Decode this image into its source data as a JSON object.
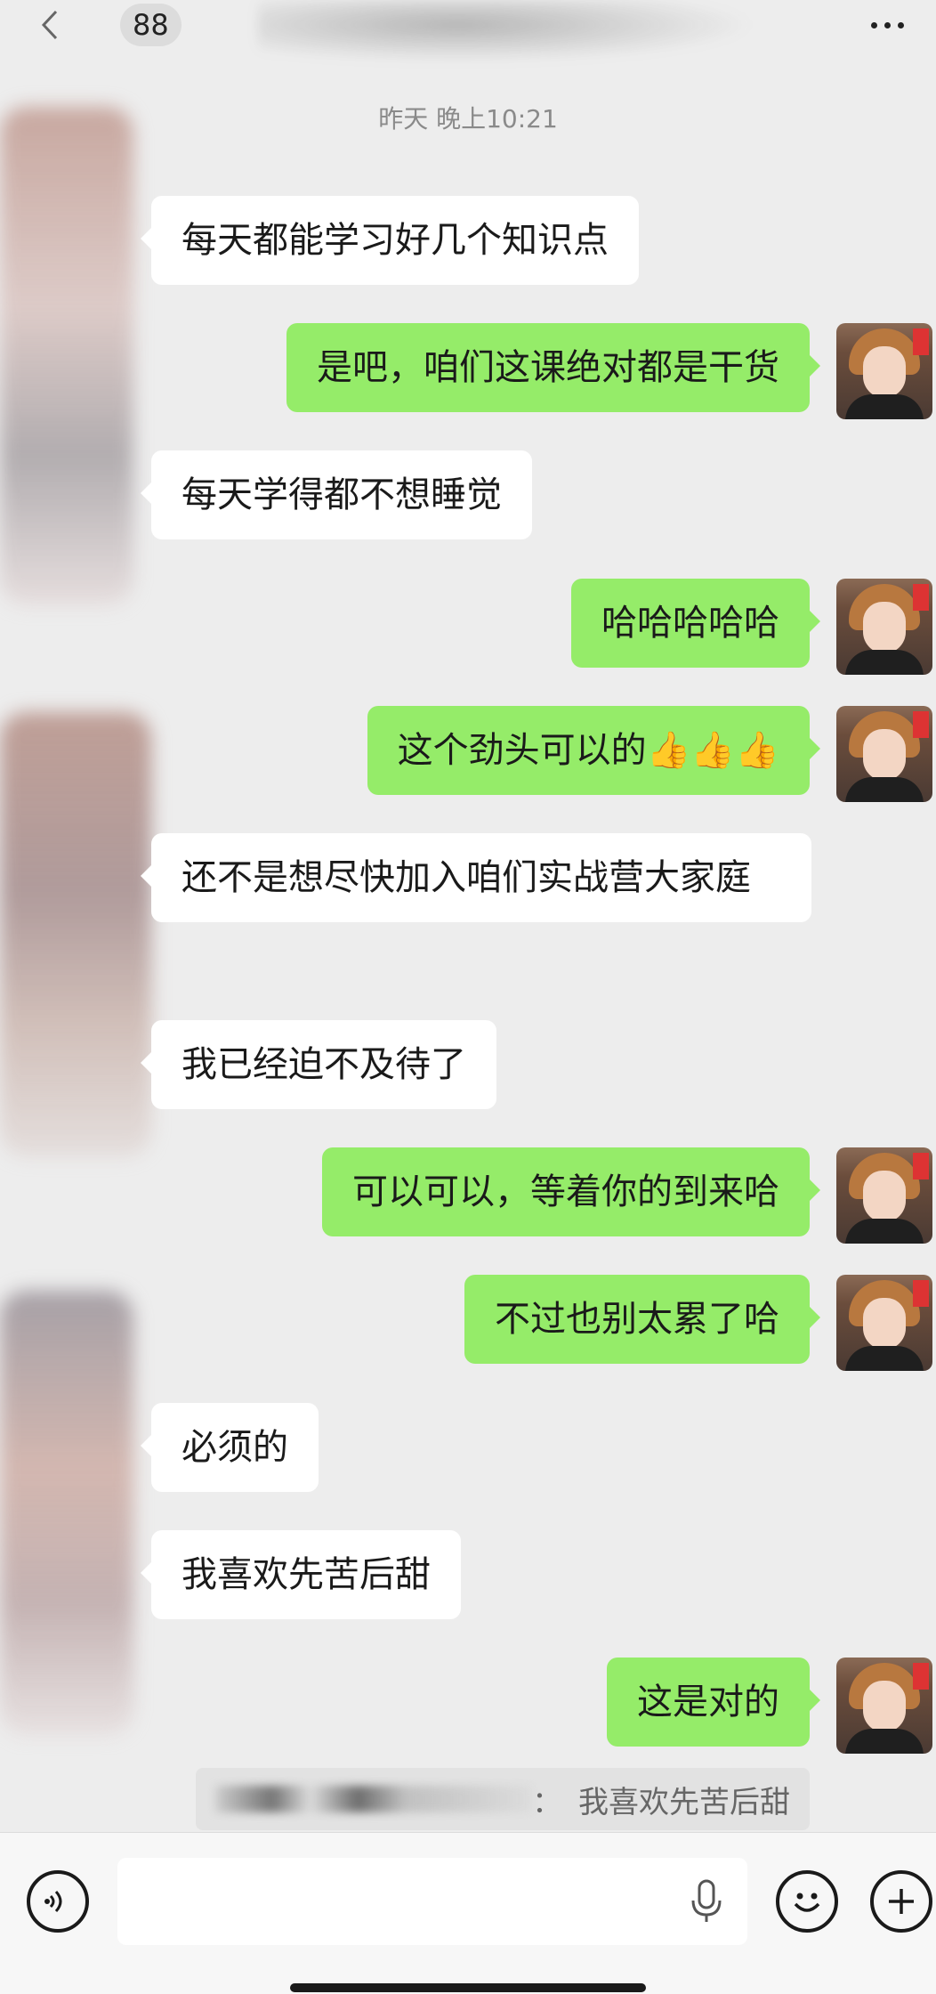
{
  "header": {
    "unread_count": "88",
    "back_icon": "chevron-left-icon",
    "more_icon": "more-dots-icon"
  },
  "timestamp": "昨天 晚上10:21",
  "messages": [
    {
      "side": "recv",
      "text": "每天都能学习好几个知识点"
    },
    {
      "side": "sent",
      "text": "是吧，咱们这课绝对都是干货"
    },
    {
      "side": "recv",
      "text": "每天学得都不想睡觉"
    },
    {
      "side": "sent",
      "text": "哈哈哈哈哈"
    },
    {
      "side": "sent",
      "text": "这个劲头可以的👍👍👍"
    },
    {
      "side": "recv",
      "text": "还不是想尽快加入咱们实战营大家庭"
    },
    {
      "side": "recv",
      "text": "我已经迫不及待了"
    },
    {
      "side": "sent",
      "text": "可以可以，等着你的到来哈"
    },
    {
      "side": "sent",
      "text": "不过也别太累了哈"
    },
    {
      "side": "recv",
      "text": "必须的"
    },
    {
      "side": "recv",
      "text": "我喜欢先苦后甜"
    },
    {
      "side": "sent",
      "text": "这是对的"
    }
  ],
  "quote": {
    "separator": "：",
    "text": "我喜欢先苦后甜"
  },
  "input_bar": {
    "voice_icon": "voice-icon",
    "mic_icon": "mic-icon",
    "emoji_icon": "emoji-icon",
    "plus_icon": "plus-icon"
  },
  "colors": {
    "background": "#ededed",
    "sent_bubble": "#95ec69",
    "recv_bubble": "#ffffff"
  }
}
